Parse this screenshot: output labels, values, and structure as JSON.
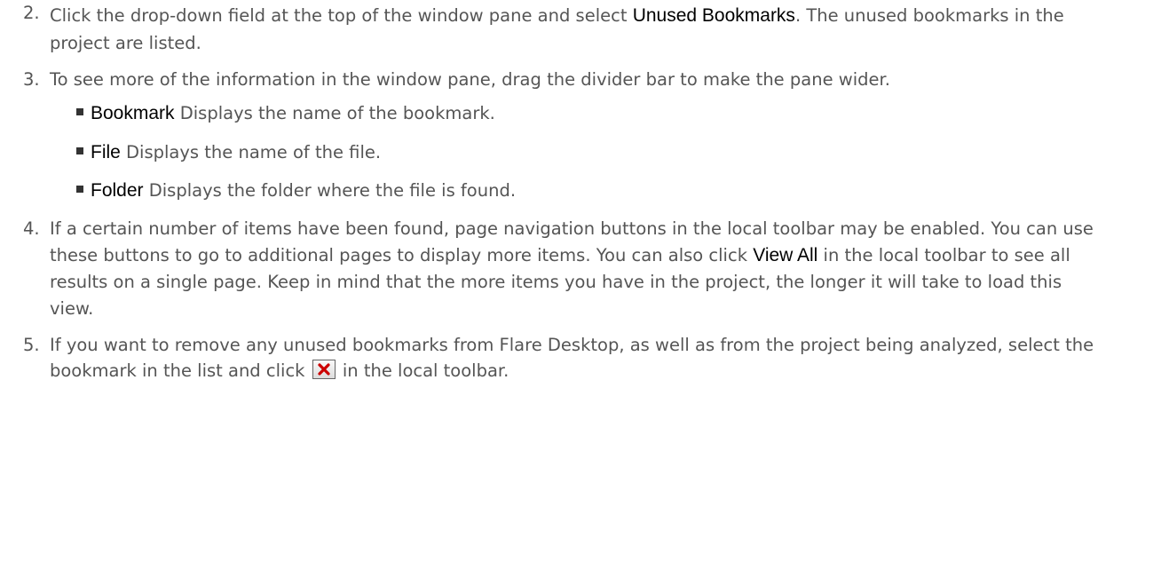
{
  "steps": [
    {
      "number": "2.",
      "parts": [
        "Click the drop-down field at the top of the window pane and select ",
        "Unused Bookmarks",
        ". The unused bookmarks in the project are listed."
      ]
    },
    {
      "number": "3.",
      "text": "To see more of the information in the window pane, drag the divider bar to make the pane wider.",
      "bullets": [
        {
          "term": "Bookmark",
          "desc": " Displays the name of the bookmark."
        },
        {
          "term": "File",
          "desc": " Displays the name of the file."
        },
        {
          "term": "Folder",
          "desc": " Displays the folder where the file is found."
        }
      ]
    },
    {
      "number": "4.",
      "parts": [
        "If a certain number of items have been found, page navigation buttons in the local toolbar may be enabled. You can use these buttons to go to additional pages to display more items. You can also click ",
        "View All",
        " in the local toolbar to see all results on a single page. Keep in mind that the more items you have in the project, the longer it will take to load this view."
      ]
    },
    {
      "number": "5.",
      "parts": [
        "If you want to remove any unused bookmarks from Flare Desktop, as well as from the project being analyzed, select the bookmark in the list and click ",
        " in the local toolbar."
      ],
      "icon": "delete-x-icon"
    }
  ],
  "colors": {
    "body_text": "#555555",
    "ui_term": "#000000",
    "delete_icon": "#cc0000"
  }
}
